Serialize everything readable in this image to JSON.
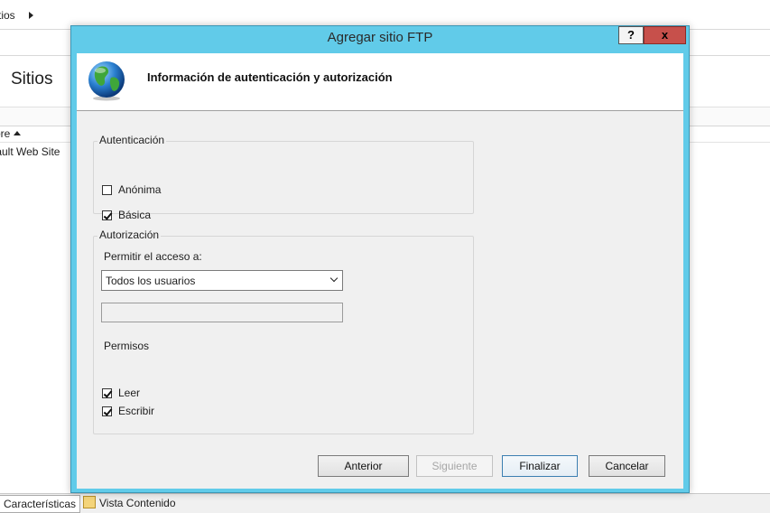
{
  "background": {
    "breadcrumb": "tios",
    "page_title": "Sitios",
    "column_header": "ore",
    "site_row": "fault Web Site",
    "tabs": [
      "Características",
      "Vista Contenido"
    ]
  },
  "dialog": {
    "title": "Agregar sitio FTP",
    "help_button": "?",
    "close_button": "x",
    "header": "Información de autenticación y autorización",
    "authentication": {
      "legend": "Autenticación",
      "options": [
        {
          "label": "Anónima",
          "checked": false
        },
        {
          "label": "Básica",
          "checked": true
        }
      ]
    },
    "authorization": {
      "legend": "Autorización",
      "allow_access_label": "Permitir el acceso a:",
      "allow_access_value": "Todos los usuarios",
      "user_field_value": "",
      "permissions_label": "Permisos",
      "permissions": [
        {
          "label": "Leer",
          "checked": true
        },
        {
          "label": "Escribir",
          "checked": true
        }
      ]
    },
    "buttons": {
      "previous": "Anterior",
      "next": "Siguiente",
      "finish": "Finalizar",
      "cancel": "Cancelar"
    }
  },
  "colors": {
    "dialog_frame": "#61cbe9",
    "close_button": "#c7504b",
    "client_background": "#f0f0f0"
  }
}
